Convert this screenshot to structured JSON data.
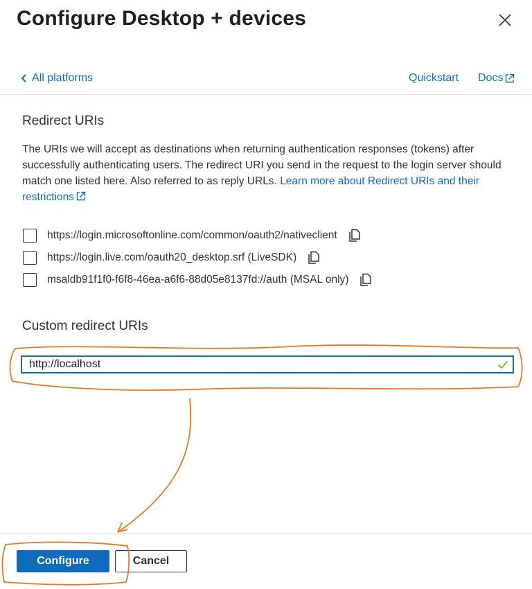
{
  "dialog": {
    "title": "Configure Desktop + devices"
  },
  "nav": {
    "back_label": "All platforms",
    "quickstart_label": "Quickstart",
    "docs_label": "Docs"
  },
  "redirect": {
    "heading": "Redirect URIs",
    "description": "The URIs we will accept as destinations when returning authentication responses (tokens) after successfully authenticating users. The redirect URI you send in the request to the login server should match one listed here. Also referred to as reply URLs. ",
    "learn_more_label": "Learn more about Redirect URIs and their restrictions",
    "uris": [
      {
        "url": "https://login.microsoftonline.com/common/oauth2/nativeclient",
        "checked": false
      },
      {
        "url": "https://login.live.com/oauth20_desktop.srf (LiveSDK)",
        "checked": false
      },
      {
        "url": "msaldb91f1f0-f6f8-46ea-a6f6-88d05e8137fd://auth (MSAL only)",
        "checked": false
      }
    ]
  },
  "custom": {
    "heading": "Custom redirect URIs",
    "value": "http://localhost",
    "valid": true
  },
  "footer": {
    "configure_label": "Configure",
    "cancel_label": "Cancel"
  },
  "colors": {
    "accent": "#0f6cbd",
    "annotation": "#e87722",
    "valid": "#6bb700"
  }
}
